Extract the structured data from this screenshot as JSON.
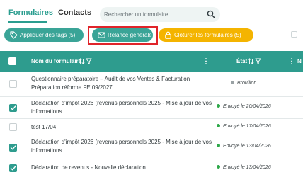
{
  "tabs": {
    "formulaires": "Formulaires",
    "contacts": "Contacts"
  },
  "search": {
    "placeholder": "Rechercher un formulaire..."
  },
  "toolbar": {
    "tags_label": "Appliquer des tags (5)",
    "relance_label": "Relance générale",
    "cloturer_label": "Clôturer les formulaires (5)"
  },
  "table": {
    "headers": {
      "nom": "Nom du formulaire",
      "etat": "État",
      "n": "N"
    },
    "rows": [
      {
        "name": "Questionnaire préparatoire – Audit de vos Ventes & Facturation Préparation réforme FE 09/2027",
        "status": "Brouillon",
        "status_color": "#9aa2a5",
        "checked": false
      },
      {
        "name": "Déclaration d'impôt 2026 (revenus personnels 2025 - Mise à jour de vos informations",
        "status": "Envoyé le 20/04/2026",
        "status_color": "#2fa84a",
        "checked": true
      },
      {
        "name": "test 17/04",
        "status": "Envoyé le 17/04/2026",
        "status_color": "#2fa84a",
        "checked": false
      },
      {
        "name": "Déclaration d'impôt 2026 (revenus personnels 2025 - Mise à jour de vos informations",
        "status": "Envoyé le 13/04/2026",
        "status_color": "#2fa84a",
        "checked": true
      },
      {
        "name": "Déclaration de revenus - Nouvelle déclaration",
        "status": "Envoyé le 13/04/2026",
        "status_color": "#2fa84a",
        "checked": true
      }
    ]
  },
  "colors": {
    "primary": "#2e9c8e",
    "warning": "#f4b400",
    "focus": "#e0242a"
  },
  "icons": {
    "tags": "tag-icon",
    "relance": "envelope-icon",
    "cloturer": "lock-icon",
    "search": "search-icon"
  }
}
